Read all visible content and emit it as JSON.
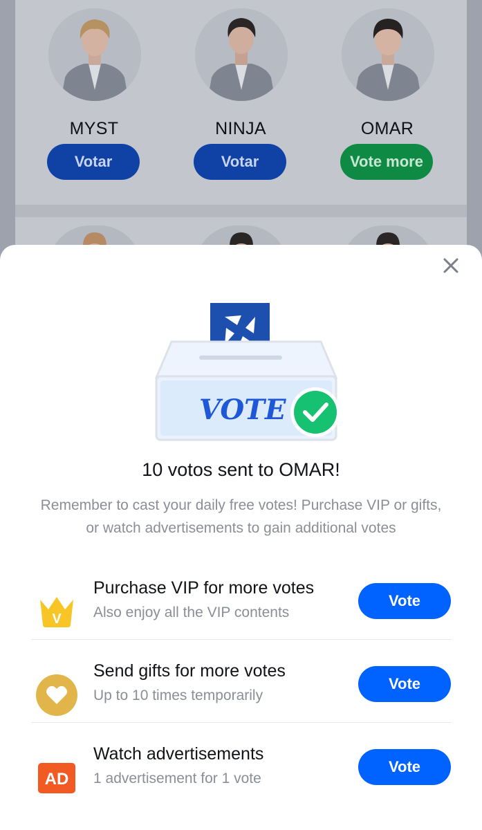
{
  "candidates": [
    {
      "name": "MYST",
      "button": "Votar",
      "state": "blue"
    },
    {
      "name": "NINJA",
      "button": "Votar",
      "state": "blue"
    },
    {
      "name": "OMAR",
      "button": "Vote more",
      "state": "green"
    }
  ],
  "modal": {
    "title": "10 votos sent to OMAR!",
    "description": "Remember to cast your daily free votes! Purchase VIP or gifts, or watch advertisements to gain additional votes",
    "hero_text": "VOTE",
    "options": [
      {
        "title": "Purchase VIP for more votes",
        "subtitle": "Also enjoy all the VIP contents",
        "button": "Vote",
        "icon": "crown-v-icon",
        "icon_text": "V"
      },
      {
        "title": "Send gifts for more votes",
        "subtitle": "Up to 10 times temporarily",
        "button": "Vote",
        "icon": "heart-icon"
      },
      {
        "title": "Watch advertisements",
        "subtitle": "1 advertisement for 1 vote",
        "button": "Vote",
        "icon": "ad-icon",
        "icon_text": "AD"
      }
    ]
  },
  "colors": {
    "primary_blue": "#0062ff",
    "vote_more_green": "#0e8a45",
    "check_green": "#16c172",
    "crown_yellow": "#f7c526",
    "heart_gold": "#e2b54a",
    "ad_orange": "#f25a23"
  }
}
